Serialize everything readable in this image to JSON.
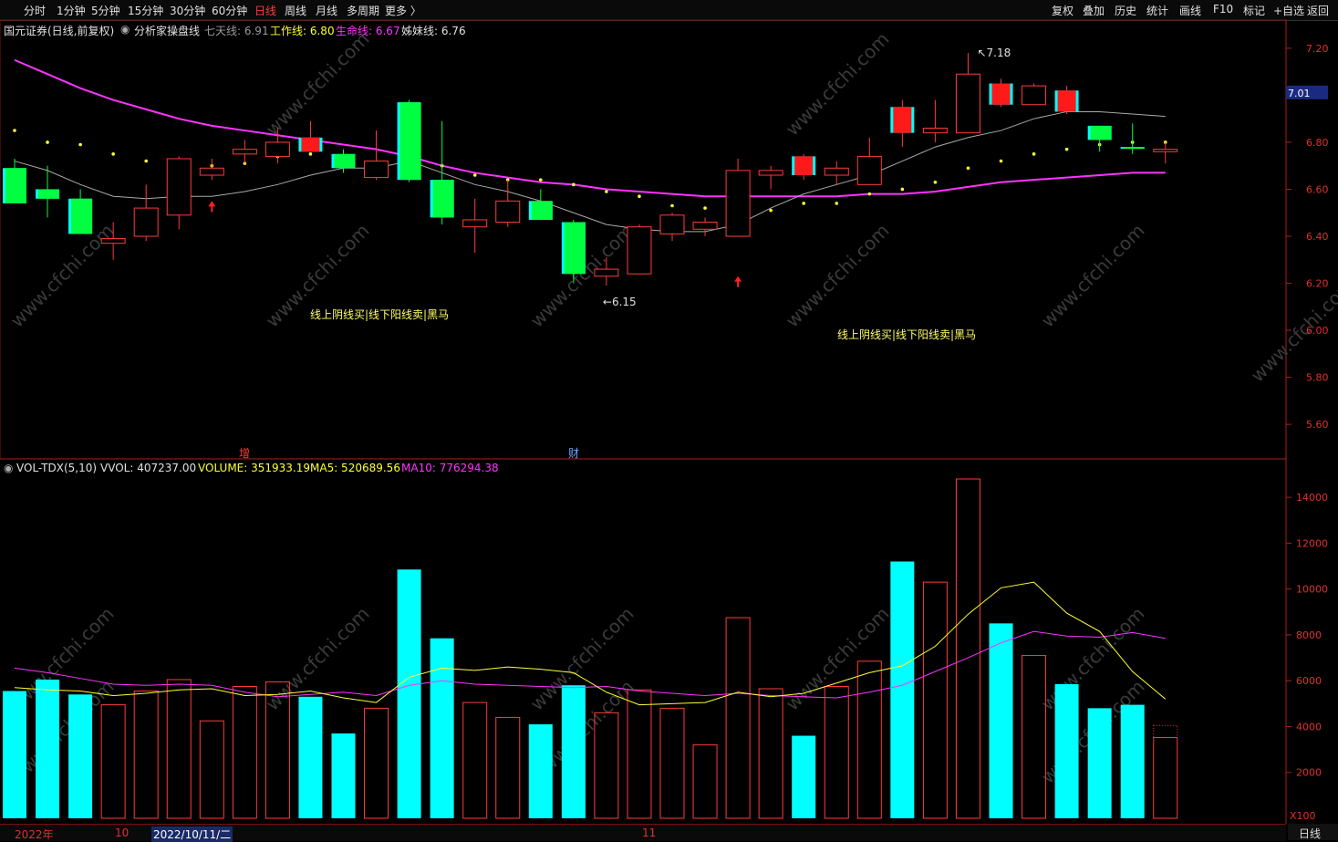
{
  "toolbar": {
    "periods": [
      "分时",
      "1分钟",
      "5分钟",
      "15分钟",
      "30分钟",
      "60分钟",
      "日线",
      "周线",
      "月线",
      "多周期",
      "更多 〉"
    ],
    "active_period": "日线",
    "right_buttons": [
      "复权",
      "叠加",
      "历史",
      "统计",
      "画线",
      "F10",
      "标记",
      "+自选",
      "返回"
    ]
  },
  "main_info": {
    "title": "国元证券(日线,前复权)",
    "indicator": "分析家操盘线",
    "qitian_label": "七天线: 6.91",
    "gongzuo_label": "工作线: 6.80",
    "shengming_label": "生命线: 6.67",
    "jiemei_label": "姊妹线: 6.76"
  },
  "vol_info": {
    "name": "VOL-TDX(5,10)",
    "vvol": "VVOL: 407237.00",
    "volume": "VOLUME: 351933.19",
    "ma5": "MA5: 520689.56",
    "ma10": "MA10: 776294.38"
  },
  "price_axis": {
    "ticks": [
      "7.20",
      "7.00",
      "6.80",
      "6.60",
      "6.40",
      "6.20",
      "6.00",
      "5.80",
      "5.60"
    ],
    "current": "7.01"
  },
  "volume_axis": {
    "ticks": [
      "14000",
      "12000",
      "10000",
      "8000",
      "6000",
      "4000",
      "2000"
    ],
    "unit": "X100"
  },
  "annotations": {
    "high": "7.18",
    "low": "6.15",
    "signal_text_1": "线上阴线买|线下阳线卖|黑马",
    "signal_text_2": "线上阴线买|线下阳线卖|黑马",
    "tag_1": "增",
    "tag_2": "财"
  },
  "date_bar": {
    "year": "2022年",
    "month_10": "10",
    "cursor_date": "2022/10/11/二",
    "month_11": "11"
  },
  "bottom_right": "日线",
  "watermark": "www.cfchi.com",
  "colors": {
    "up": "#ff3b3b",
    "down": "#00ffff",
    "down_body_green": "#00ff40",
    "shengming": "#ff33ff",
    "qitian": "#aaaaaa",
    "ma5": "#ffff33",
    "ma10": "#ff33ff"
  },
  "chart_data": {
    "type": "candlestick",
    "candles": [
      {
        "o": 6.69,
        "c": 6.54,
        "h": 6.73,
        "l": 6.54,
        "v": 5550,
        "k": "g"
      },
      {
        "o": 6.6,
        "c": 6.56,
        "h": 6.7,
        "l": 6.48,
        "v": 6050,
        "k": "g"
      },
      {
        "o": 6.56,
        "c": 6.41,
        "h": 6.6,
        "l": 6.41,
        "v": 5400,
        "k": "g"
      },
      {
        "o": 6.37,
        "c": 6.39,
        "h": 6.46,
        "l": 6.3,
        "v": 4950,
        "k": "r"
      },
      {
        "o": 6.4,
        "c": 6.52,
        "h": 6.62,
        "l": 6.38,
        "v": 5550,
        "k": "r"
      },
      {
        "o": 6.49,
        "c": 6.73,
        "h": 6.74,
        "l": 6.43,
        "v": 6050,
        "k": "r"
      },
      {
        "o": 6.66,
        "c": 6.69,
        "h": 6.73,
        "l": 6.64,
        "v": 4250,
        "k": "r"
      },
      {
        "o": 6.75,
        "c": 6.77,
        "h": 6.81,
        "l": 6.71,
        "v": 5750,
        "k": "r"
      },
      {
        "o": 6.74,
        "c": 6.8,
        "h": 6.86,
        "l": 6.71,
        "v": 5950,
        "k": "r"
      },
      {
        "o": 6.82,
        "c": 6.76,
        "h": 6.89,
        "l": 6.76,
        "v": 5300,
        "k": "rg"
      },
      {
        "o": 6.75,
        "c": 6.69,
        "h": 6.77,
        "l": 6.67,
        "v": 3700,
        "k": "g"
      },
      {
        "o": 6.65,
        "c": 6.72,
        "h": 6.85,
        "l": 6.64,
        "v": 4800,
        "k": "r"
      },
      {
        "o": 6.97,
        "c": 6.64,
        "h": 6.98,
        "l": 6.63,
        "v": 10850,
        "k": "g"
      },
      {
        "o": 6.64,
        "c": 6.48,
        "h": 6.89,
        "l": 6.45,
        "v": 7850,
        "k": "g"
      },
      {
        "o": 6.44,
        "c": 6.47,
        "h": 6.56,
        "l": 6.33,
        "v": 5050,
        "k": "r"
      },
      {
        "o": 6.46,
        "c": 6.55,
        "h": 6.64,
        "l": 6.44,
        "v": 4400,
        "k": "r"
      },
      {
        "o": 6.55,
        "c": 6.47,
        "h": 6.6,
        "l": 6.47,
        "v": 4100,
        "k": "g"
      },
      {
        "o": 6.46,
        "c": 6.24,
        "h": 6.47,
        "l": 6.2,
        "v": 5800,
        "k": "g"
      },
      {
        "o": 6.23,
        "c": 6.26,
        "h": 6.31,
        "l": 6.19,
        "v": 4600,
        "k": "r"
      },
      {
        "o": 6.24,
        "c": 6.44,
        "h": 6.45,
        "l": 6.24,
        "v": 5600,
        "k": "r"
      },
      {
        "o": 6.41,
        "c": 6.49,
        "h": 6.5,
        "l": 6.38,
        "v": 4800,
        "k": "r"
      },
      {
        "o": 6.43,
        "c": 6.46,
        "h": 6.48,
        "l": 6.4,
        "v": 3200,
        "k": "r"
      },
      {
        "o": 6.4,
        "c": 6.68,
        "h": 6.73,
        "l": 6.4,
        "v": 8750,
        "k": "r"
      },
      {
        "o": 6.66,
        "c": 6.68,
        "h": 6.7,
        "l": 6.6,
        "v": 5650,
        "k": "r"
      },
      {
        "o": 6.74,
        "c": 6.66,
        "h": 6.75,
        "l": 6.64,
        "v": 3600,
        "k": "rg"
      },
      {
        "o": 6.66,
        "c": 6.69,
        "h": 6.72,
        "l": 6.62,
        "v": 5750,
        "k": "r"
      },
      {
        "o": 6.62,
        "c": 6.74,
        "h": 6.82,
        "l": 6.62,
        "v": 6850,
        "k": "r"
      },
      {
        "o": 6.95,
        "c": 6.84,
        "h": 6.98,
        "l": 6.78,
        "v": 11200,
        "k": "rg"
      },
      {
        "o": 6.84,
        "c": 6.86,
        "h": 6.98,
        "l": 6.8,
        "v": 10300,
        "k": "r"
      },
      {
        "o": 6.84,
        "c": 7.09,
        "h": 7.18,
        "l": 6.84,
        "v": 14800,
        "k": "r"
      },
      {
        "o": 7.05,
        "c": 6.96,
        "h": 7.07,
        "l": 6.95,
        "v": 8500,
        "k": "rg"
      },
      {
        "o": 6.96,
        "c": 7.04,
        "h": 7.05,
        "l": 6.96,
        "v": 7100,
        "k": "r"
      },
      {
        "o": 7.02,
        "c": 6.93,
        "h": 7.04,
        "l": 6.92,
        "v": 5850,
        "k": "rg"
      },
      {
        "o": 6.87,
        "c": 6.81,
        "h": 6.87,
        "l": 6.76,
        "v": 4800,
        "k": "g"
      },
      {
        "o": 6.78,
        "c": 6.78,
        "h": 6.88,
        "l": 6.75,
        "v": 4950,
        "k": "g"
      },
      {
        "o": 6.77,
        "c": 6.76,
        "h": 6.8,
        "l": 6.71,
        "v": 3520,
        "k": "r"
      }
    ],
    "qitian_line": [
      6.72,
      6.68,
      6.62,
      6.57,
      6.56,
      6.57,
      6.57,
      6.59,
      6.62,
      6.66,
      6.69,
      6.69,
      6.72,
      6.67,
      6.62,
      6.59,
      6.55,
      6.5,
      6.45,
      6.43,
      6.42,
      6.42,
      6.45,
      6.52,
      6.58,
      6.62,
      6.66,
      6.72,
      6.78,
      6.82,
      6.85,
      6.9,
      6.93,
      6.93,
      6.92,
      6.91
    ],
    "shengming_line": [
      7.15,
      7.09,
      7.03,
      6.98,
      6.94,
      6.9,
      6.87,
      6.85,
      6.83,
      6.81,
      6.79,
      6.77,
      6.74,
      6.7,
      6.67,
      6.65,
      6.63,
      6.62,
      6.6,
      6.59,
      6.58,
      6.57,
      6.57,
      6.57,
      6.57,
      6.57,
      6.58,
      6.58,
      6.59,
      6.61,
      6.63,
      6.64,
      6.65,
      6.66,
      6.67,
      6.67
    ],
    "gongzuo_dots": [
      6.85,
      6.8,
      6.79,
      6.75,
      6.72,
      6.71,
      6.7,
      6.71,
      6.74,
      6.75,
      6.73,
      6.71,
      6.72,
      6.7,
      6.66,
      6.64,
      6.64,
      6.62,
      6.59,
      6.57,
      6.53,
      6.52,
      6.51,
      6.51,
      6.54,
      6.54,
      6.58,
      6.6,
      6.63,
      6.69,
      6.72,
      6.75,
      6.77,
      6.79,
      6.8,
      6.8
    ],
    "ma5": [
      5700,
      5600,
      5550,
      5350,
      5450,
      5600,
      5650,
      5350,
      5400,
      5550,
      5250,
      5050,
      6150,
      6550,
      6450,
      6600,
      6500,
      6350,
      5500,
      4950,
      5000,
      5050,
      5500,
      5300,
      5450,
      5900,
      6350,
      6650,
      7500,
      8900,
      10050,
      10300,
      8950,
      8150,
      6400,
      5200
    ],
    "ma10": [
      6550,
      6350,
      6100,
      5850,
      5800,
      5850,
      5800,
      5500,
      5300,
      5400,
      5500,
      5350,
      5800,
      6000,
      5850,
      5800,
      5750,
      5700,
      5750,
      5550,
      5450,
      5350,
      5450,
      5350,
      5300,
      5250,
      5500,
      5800,
      6400,
      7000,
      7650,
      8150,
      7950,
      7900,
      8100,
      7850
    ],
    "price_range": [
      5.55,
      7.25
    ],
    "volume_range": [
      0,
      15000
    ]
  }
}
